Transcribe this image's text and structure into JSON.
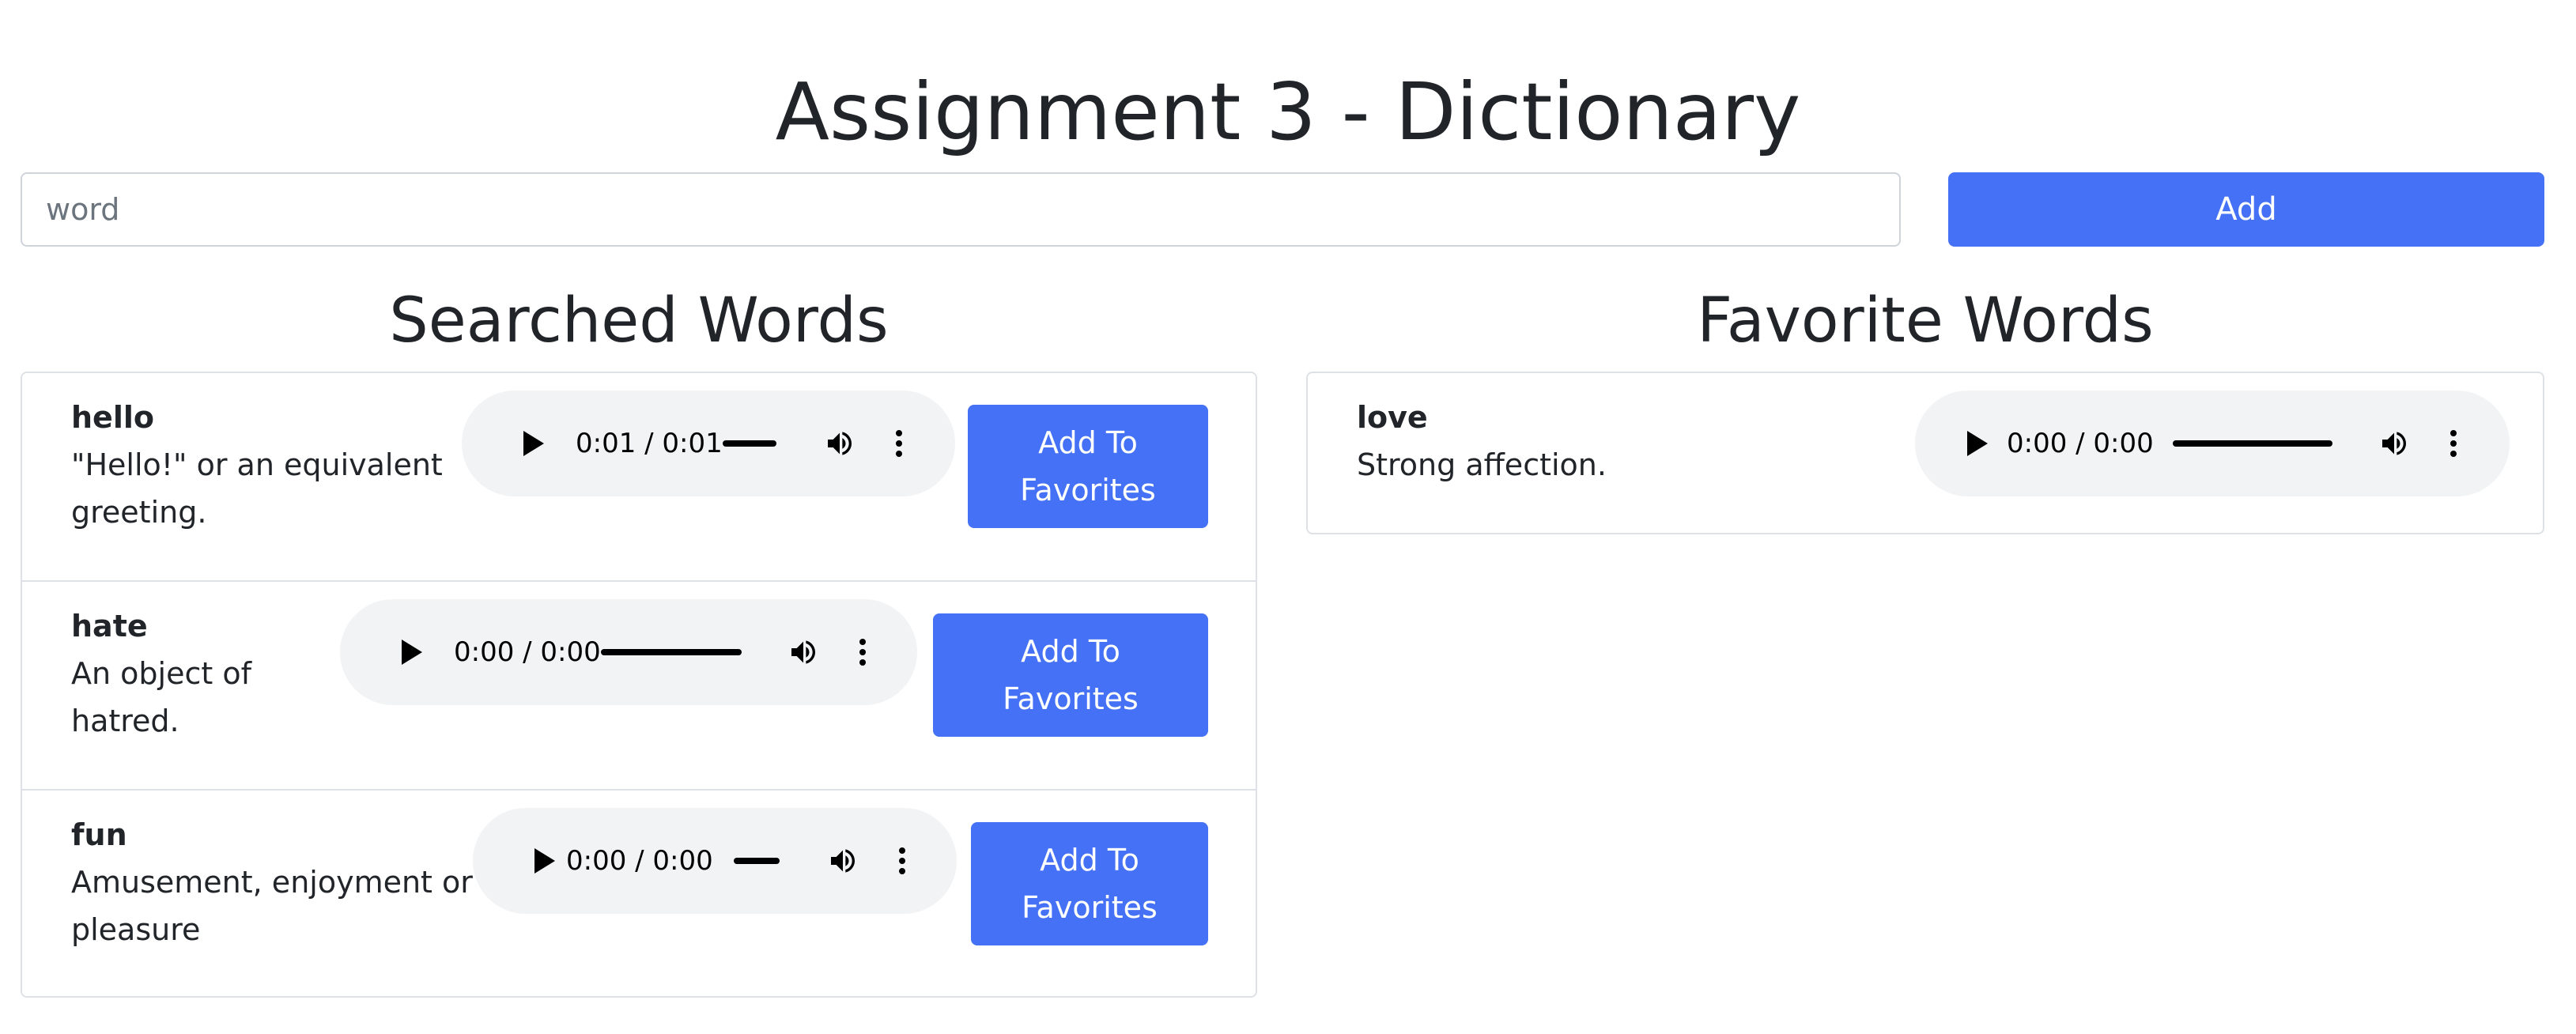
{
  "header": {
    "title": "Assignment 3 - Dictionary"
  },
  "search": {
    "placeholder": "word",
    "value": "",
    "add_label": "Add"
  },
  "searched": {
    "title": "Searched Words",
    "items": [
      {
        "word": "hello",
        "definition": "\"Hello!\" or an equivalent greeting.",
        "audio_time": "0:01 / 0:01",
        "button_label": "Add To Favorites"
      },
      {
        "word": "hate",
        "definition": "An object of hatred.",
        "audio_time": "0:00 / 0:00",
        "button_label": "Add To Favorites"
      },
      {
        "word": "fun",
        "definition": "Amusement, enjoyment or pleasure",
        "audio_time": "0:00 / 0:00",
        "button_label": "Add To Favorites"
      }
    ]
  },
  "favorites": {
    "title": "Favorite Words",
    "items": [
      {
        "word": "love",
        "definition": "Strong affection.",
        "audio_time": "0:00 / 0:00"
      }
    ]
  },
  "colors": {
    "accent": "#4471f5",
    "audio_bg": "#f1f3f4",
    "border": "#dee2e6",
    "text": "#212529"
  },
  "icons": {
    "play": "play-icon",
    "volume": "volume-icon",
    "more": "more-vertical-icon"
  }
}
